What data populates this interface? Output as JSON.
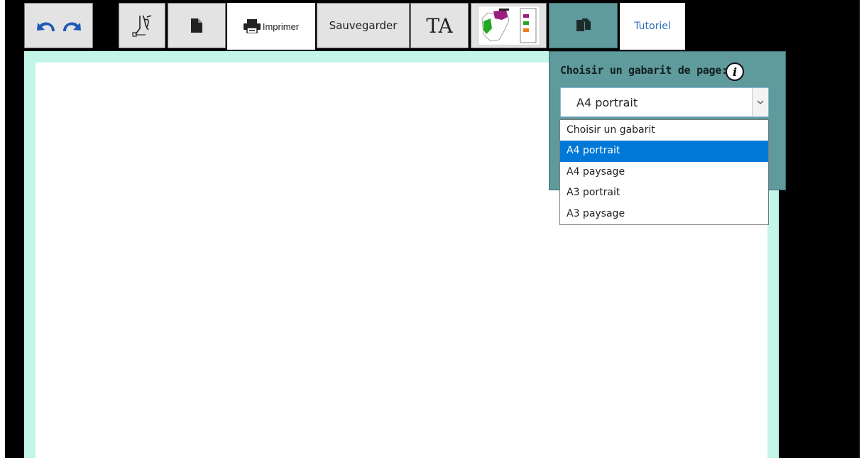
{
  "toolbar": {
    "print_label": "Imprimer",
    "save_label": "Sauvegarder",
    "text_tool_label": "TA",
    "tutorial_label": "Tutoriel"
  },
  "template_panel": {
    "title": "Choisir un gabarit de page:",
    "info_glyph": "i",
    "selected_value": "A4 portrait",
    "options": [
      "Choisir un gabarit",
      "A4 portrait",
      "A4 paysage",
      "A3 portrait",
      "A3 paysage"
    ],
    "selected_index": 1
  },
  "colors": {
    "toolbar_button_bg": "#e3e3e3",
    "panel_bg": "#5f9a9c",
    "canvas_border": "#c2f4e8",
    "selection_blue": "#0078d7",
    "icon_blue": "#1e5bb5"
  }
}
